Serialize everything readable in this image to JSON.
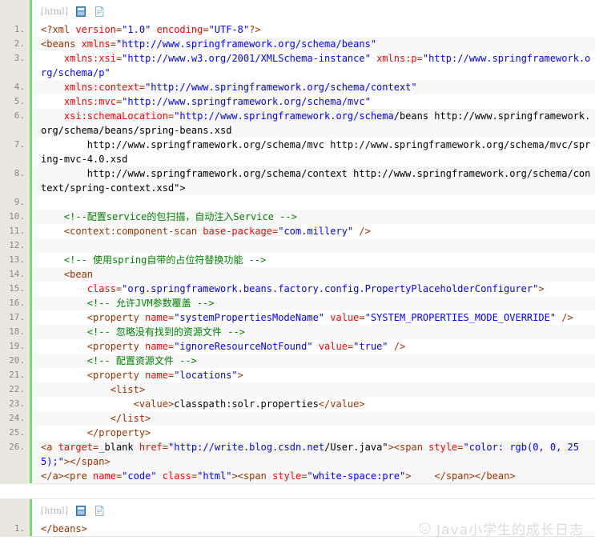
{
  "theme": {
    "gutter_bg": "#e8e6df",
    "gutter_accent": "#6ce26c",
    "line_alt_bg": "#f7f7f7",
    "tag_color": "#993300",
    "attr_color": "#ff0000",
    "value_color": "#0000ff",
    "comment_color": "#008200",
    "text_color": "#000000",
    "lang_label_color": "#b9b9b9"
  },
  "blocks": [
    {
      "toolbar": {
        "lang_label": "[html]",
        "copy_icon": "copy-icon",
        "view_plain_icon": "view-plain-icon"
      },
      "line_numbers": [
        "1.",
        "2.",
        "3.",
        "",
        "4.",
        "5.",
        "6.",
        "",
        "7.",
        "",
        "8.",
        "",
        "9.",
        "10.",
        "11.",
        "12.",
        "13.",
        "14.",
        "15.",
        "16.",
        "17.",
        "18.",
        "19.",
        "20.",
        "21.",
        "22.",
        "23.",
        "24.",
        "25.",
        "26.",
        "",
        ""
      ],
      "lines": [
        {
          "n": "1.",
          "tokens": [
            {
              "t": "tag",
              "s": "<?xml "
            },
            {
              "t": "attr",
              "s": "version"
            },
            {
              "t": "tag",
              "s": "="
            },
            {
              "t": "value",
              "s": "\"1.0\""
            },
            {
              "t": "tag",
              "s": " "
            },
            {
              "t": "attr",
              "s": "encoding"
            },
            {
              "t": "tag",
              "s": "="
            },
            {
              "t": "value",
              "s": "\"UTF-8\""
            },
            {
              "t": "tag",
              "s": "?>"
            }
          ]
        },
        {
          "n": "2.",
          "tokens": [
            {
              "t": "tag",
              "s": "<beans "
            },
            {
              "t": "attr",
              "s": "xmlns"
            },
            {
              "t": "tag",
              "s": "="
            },
            {
              "t": "value",
              "s": "\"http://www.springframework.org/schema/beans\""
            }
          ]
        },
        {
          "n": "3.",
          "tokens": [
            {
              "t": "plain",
              "s": "    "
            },
            {
              "t": "attr",
              "s": "xmlns:xsi"
            },
            {
              "t": "tag",
              "s": "="
            },
            {
              "t": "value",
              "s": "\"http://www.w3.org/2001/XMLSchema-instance\""
            },
            {
              "t": "tag",
              "s": " "
            },
            {
              "t": "attr",
              "s": "xmlns:p"
            },
            {
              "t": "tag",
              "s": "="
            },
            {
              "t": "value",
              "s": "\"http://www.springframework.org/schema/p\""
            }
          ]
        },
        {
          "n": "4.",
          "tokens": [
            {
              "t": "plain",
              "s": "    "
            },
            {
              "t": "attr",
              "s": "xmlns:context"
            },
            {
              "t": "tag",
              "s": "="
            },
            {
              "t": "value",
              "s": "\"http://www.springframework.org/schema/context\""
            }
          ]
        },
        {
          "n": "5.",
          "tokens": [
            {
              "t": "plain",
              "s": "    "
            },
            {
              "t": "attr",
              "s": "xmlns:mvc"
            },
            {
              "t": "tag",
              "s": "="
            },
            {
              "t": "value",
              "s": "\"http://www.springframework.org/schema/mvc\""
            }
          ]
        },
        {
          "n": "6.",
          "tokens": [
            {
              "t": "plain",
              "s": "    "
            },
            {
              "t": "attr",
              "s": "xsi:schemaLocation"
            },
            {
              "t": "tag",
              "s": "="
            },
            {
              "t": "value",
              "s": "\"http://www.springframework.org/schema"
            },
            {
              "t": "plain",
              "s": "/beans http://www.springframework.org/schema/beans/spring-beans.xsd"
            }
          ]
        },
        {
          "n": "7.",
          "tokens": [
            {
              "t": "plain",
              "s": "        http://www.springframework.org/schema/mvc http://www.springframework.org/schema/mvc/spring-mvc-4.0.xsd"
            }
          ]
        },
        {
          "n": "8.",
          "tokens": [
            {
              "t": "plain",
              "s": "        http://www.springframework.org/schema/context http://www.springframework.org/schema/context/spring-context.xsd\">"
            }
          ]
        },
        {
          "n": "9.",
          "tokens": []
        },
        {
          "n": "10.",
          "tokens": [
            {
              "t": "plain",
              "s": "    "
            },
            {
              "t": "comment",
              "s": "<!--配置service的包扫描，自动注入Service -->"
            }
          ]
        },
        {
          "n": "11.",
          "tokens": [
            {
              "t": "plain",
              "s": "    "
            },
            {
              "t": "tag",
              "s": "<context:component-scan "
            },
            {
              "t": "attr",
              "s": "base-package"
            },
            {
              "t": "tag",
              "s": "="
            },
            {
              "t": "value",
              "s": "\"com.millery\""
            },
            {
              "t": "tag",
              "s": " />"
            }
          ]
        },
        {
          "n": "12.",
          "tokens": []
        },
        {
          "n": "13.",
          "tokens": [
            {
              "t": "plain",
              "s": "    "
            },
            {
              "t": "comment",
              "s": "<!-- 使用spring自带的占位符替换功能 -->"
            }
          ]
        },
        {
          "n": "14.",
          "tokens": [
            {
              "t": "plain",
              "s": "    "
            },
            {
              "t": "tag",
              "s": "<bean"
            }
          ]
        },
        {
          "n": "15.",
          "tokens": [
            {
              "t": "plain",
              "s": "        "
            },
            {
              "t": "attr",
              "s": "class"
            },
            {
              "t": "tag",
              "s": "="
            },
            {
              "t": "value",
              "s": "\"org.springframework.beans.factory.config.PropertyPlaceholderConfigurer\""
            },
            {
              "t": "tag",
              "s": ">"
            }
          ]
        },
        {
          "n": "16.",
          "tokens": [
            {
              "t": "plain",
              "s": "        "
            },
            {
              "t": "comment",
              "s": "<!-- 允许JVM参数覆盖 -->"
            }
          ]
        },
        {
          "n": "17.",
          "tokens": [
            {
              "t": "plain",
              "s": "        "
            },
            {
              "t": "tag",
              "s": "<property "
            },
            {
              "t": "attr",
              "s": "name"
            },
            {
              "t": "tag",
              "s": "="
            },
            {
              "t": "value",
              "s": "\"systemPropertiesModeName\""
            },
            {
              "t": "tag",
              "s": " "
            },
            {
              "t": "attr",
              "s": "value"
            },
            {
              "t": "tag",
              "s": "="
            },
            {
              "t": "value",
              "s": "\"SYSTEM_PROPERTIES_MODE_OVERRIDE\""
            },
            {
              "t": "tag",
              "s": " />"
            }
          ]
        },
        {
          "n": "18.",
          "tokens": [
            {
              "t": "plain",
              "s": "        "
            },
            {
              "t": "comment",
              "s": "<!-- 忽略没有找到的资源文件 -->"
            }
          ]
        },
        {
          "n": "19.",
          "tokens": [
            {
              "t": "plain",
              "s": "        "
            },
            {
              "t": "tag",
              "s": "<property "
            },
            {
              "t": "attr",
              "s": "name"
            },
            {
              "t": "tag",
              "s": "="
            },
            {
              "t": "value",
              "s": "\"ignoreResourceNotFound\""
            },
            {
              "t": "tag",
              "s": " "
            },
            {
              "t": "attr",
              "s": "value"
            },
            {
              "t": "tag",
              "s": "="
            },
            {
              "t": "value",
              "s": "\"true\""
            },
            {
              "t": "tag",
              "s": " />"
            }
          ]
        },
        {
          "n": "20.",
          "tokens": [
            {
              "t": "plain",
              "s": "        "
            },
            {
              "t": "comment",
              "s": "<!-- 配置资源文件 -->"
            }
          ]
        },
        {
          "n": "21.",
          "tokens": [
            {
              "t": "plain",
              "s": "        "
            },
            {
              "t": "tag",
              "s": "<property "
            },
            {
              "t": "attr",
              "s": "name"
            },
            {
              "t": "tag",
              "s": "="
            },
            {
              "t": "value",
              "s": "\"locations\""
            },
            {
              "t": "tag",
              "s": ">"
            }
          ]
        },
        {
          "n": "22.",
          "tokens": [
            {
              "t": "plain",
              "s": "            "
            },
            {
              "t": "tag",
              "s": "<list>"
            }
          ]
        },
        {
          "n": "23.",
          "tokens": [
            {
              "t": "plain",
              "s": "                "
            },
            {
              "t": "tag",
              "s": "<value>"
            },
            {
              "t": "plain",
              "s": "classpath:solr.properties"
            },
            {
              "t": "tag",
              "s": "</value>"
            }
          ]
        },
        {
          "n": "24.",
          "tokens": [
            {
              "t": "plain",
              "s": "            "
            },
            {
              "t": "tag",
              "s": "</list>"
            }
          ]
        },
        {
          "n": "25.",
          "tokens": [
            {
              "t": "plain",
              "s": "        "
            },
            {
              "t": "tag",
              "s": "</property>"
            }
          ]
        },
        {
          "n": "26.",
          "tokens": [
            {
              "t": "tag",
              "s": "<a "
            },
            {
              "t": "attr",
              "s": "target"
            },
            {
              "t": "tag",
              "s": "="
            },
            {
              "t": "plain",
              "s": "_blank"
            },
            {
              "t": "tag",
              "s": " "
            },
            {
              "t": "attr",
              "s": "href"
            },
            {
              "t": "tag",
              "s": "="
            },
            {
              "t": "value",
              "s": "\"http://write.blog.csdn.net"
            },
            {
              "t": "plain",
              "s": "/User.java\""
            },
            {
              "t": "tag",
              "s": "><span "
            },
            {
              "t": "attr",
              "s": "style"
            },
            {
              "t": "tag",
              "s": "="
            },
            {
              "t": "value",
              "s": "\"color: rgb(0, 0, 255);\""
            },
            {
              "t": "tag",
              "s": "></span>"
            },
            {
              "t": "plain",
              "s": "\n"
            },
            {
              "t": "tag",
              "s": "</a><pre "
            },
            {
              "t": "attr",
              "s": "name"
            },
            {
              "t": "tag",
              "s": "="
            },
            {
              "t": "value",
              "s": "\"code\""
            },
            {
              "t": "tag",
              "s": " "
            },
            {
              "t": "attr",
              "s": "class"
            },
            {
              "t": "tag",
              "s": "="
            },
            {
              "t": "value",
              "s": "\"html\""
            },
            {
              "t": "tag",
              "s": "><span "
            },
            {
              "t": "attr",
              "s": "style"
            },
            {
              "t": "tag",
              "s": "="
            },
            {
              "t": "value",
              "s": "\"white-space:pre\""
            },
            {
              "t": "tag",
              "s": ">    </span></bean>"
            }
          ]
        }
      ]
    },
    {
      "toolbar": {
        "lang_label": "[html]",
        "copy_icon": "copy-icon",
        "view_plain_icon": "view-plain-icon"
      },
      "lines": [
        {
          "n": "1.",
          "tokens": [
            {
              "t": "tag",
              "s": "</beans>"
            }
          ]
        }
      ]
    }
  ],
  "watermark": {
    "text": "Java小学生的成长日志",
    "logo_icon": "smiley-logo-icon"
  }
}
